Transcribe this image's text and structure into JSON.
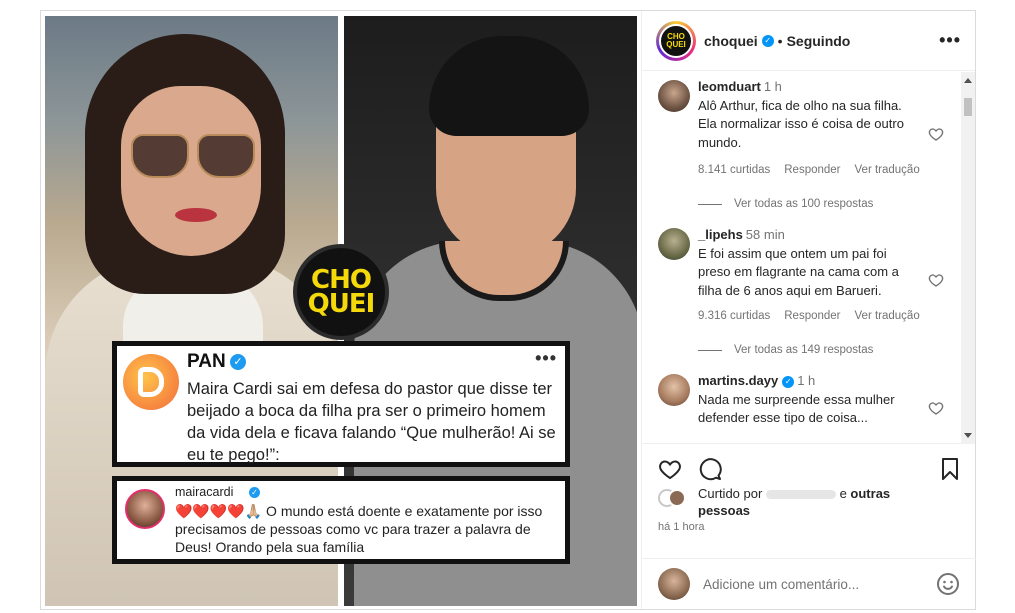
{
  "brand_overlay": "CHO QUEI",
  "pan_post": {
    "name": "PAN",
    "more": "•••",
    "body": "Maira Cardi sai em defesa do pastor que disse ter beijado a boca da filha pra ser o primeiro homem da vida dela e ficava falando “Que mulherão! Ai se eu te pego!”:"
  },
  "maira_reply": {
    "username": "mairacardi",
    "body": "❤️❤️❤️❤️🙏🏼 O mundo está doente e exatamente por isso precisamos de pessoas como vc para trazer a palavra de Deus! Orando pela sua família"
  },
  "header": {
    "avatar_text": "CHO QUEI",
    "username": "choquei",
    "separator": "•",
    "follow_label": "Seguindo",
    "more": "•••"
  },
  "comments": [
    {
      "username": "leomduart",
      "time": "1 h",
      "text": "Alô Arthur, fica de olho na sua filha. Ela normalizar isso é coisa de outro mundo.",
      "likes": "8.141 curtidas",
      "reply": "Responder",
      "translate": "Ver tradução",
      "view_replies": "Ver todas as 100 respostas"
    },
    {
      "username": "_lipehs",
      "time": "58 min",
      "text": "E foi assim que ontem um pai foi preso em flagrante na cama com a filha de 6 anos aqui em Barueri.",
      "likes": "9.316 curtidas",
      "reply": "Responder",
      "translate": "Ver tradução",
      "view_replies": "Ver todas as 149 respostas"
    },
    {
      "username": "martins.dayy",
      "time": "1 h",
      "text": "Nada me surpreende essa mulher defender esse tipo de coisa..."
    }
  ],
  "likes": {
    "prefix": "Curtido por",
    "connector": "e",
    "others": "outras pessoas"
  },
  "post_time": "há 1 hora",
  "add_comment": {
    "placeholder": "Adicione um comentário..."
  },
  "colors": {
    "verified": "#0095f6",
    "brand_yellow": "#f5d90a",
    "muted_text": "#737373"
  },
  "icons": [
    "heart-icon",
    "comment-icon",
    "bookmark-icon",
    "emoji-icon",
    "verified-icon",
    "more-icon"
  ]
}
